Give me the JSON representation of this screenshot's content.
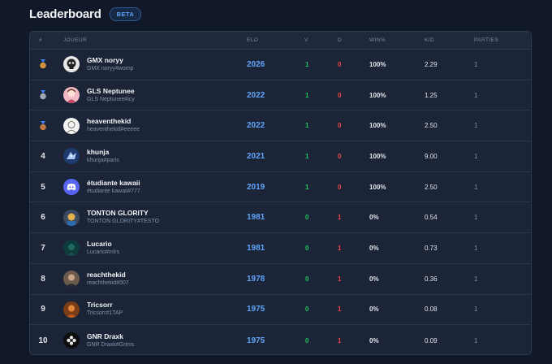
{
  "header": {
    "title": "Leaderboard",
    "badge": "BETA"
  },
  "columns": {
    "rank": "#",
    "player": "JOUEUR",
    "elo": "ELO",
    "wins": "V",
    "losses": "D",
    "winrate": "WIN%",
    "kd": "K/D",
    "games": "PARTIES"
  },
  "colors": {
    "accent": "#60a5fa",
    "win": "#22c55e",
    "loss": "#ef4444",
    "gold": "#d08c34",
    "silver": "#9ca3af",
    "bronze": "#b8703a"
  },
  "rows": [
    {
      "rank": "",
      "medal": "gold",
      "name": "GMX noryy",
      "tag": "GMX noryy#womp",
      "elo": "2026",
      "wins": "1",
      "losses": "0",
      "winrate": "100%",
      "kd": "2.29",
      "games": "1",
      "avatar": "skull-avatar"
    },
    {
      "rank": "",
      "medal": "silver",
      "name": "GLS Neptunee",
      "tag": "GLS Neptunee#icy",
      "elo": "2022",
      "wins": "1",
      "losses": "0",
      "winrate": "100%",
      "kd": "1.25",
      "games": "1",
      "avatar": "pink-character-avatar"
    },
    {
      "rank": "",
      "medal": "bronze",
      "name": "heaventhekid",
      "tag": "heaventhekid#eeeee",
      "elo": "2022",
      "wins": "1",
      "losses": "0",
      "winrate": "100%",
      "kd": "2.50",
      "games": "1",
      "avatar": "sketch-avatar"
    },
    {
      "rank": "4",
      "medal": "",
      "name": "khunja",
      "tag": "khunja#paris",
      "elo": "2021",
      "wins": "1",
      "losses": "0",
      "winrate": "100%",
      "kd": "9.00",
      "games": "1",
      "avatar": "blue-dragon-avatar"
    },
    {
      "rank": "5",
      "medal": "",
      "name": "étudiante kawaii",
      "tag": "étudiante kawaii#777",
      "elo": "2019",
      "wins": "1",
      "losses": "0",
      "winrate": "100%",
      "kd": "2.50",
      "games": "1",
      "avatar": "discord-default-avatar"
    },
    {
      "rank": "6",
      "medal": "",
      "name": "TONTON GLORITY",
      "tag": "TONTON GLORITY#TESTO",
      "elo": "1981",
      "wins": "0",
      "losses": "1",
      "winrate": "0%",
      "kd": "0.54",
      "games": "1",
      "avatar": "cartoon-avatar"
    },
    {
      "rank": "7",
      "medal": "",
      "name": "Lucario",
      "tag": "Lucario#mlrs",
      "elo": "1981",
      "wins": "0",
      "losses": "1",
      "winrate": "0%",
      "kd": "0.73",
      "games": "1",
      "avatar": "dark-teal-avatar"
    },
    {
      "rank": "8",
      "medal": "",
      "name": "reachthekid",
      "tag": "reachthekid#007",
      "elo": "1978",
      "wins": "0",
      "losses": "1",
      "winrate": "0%",
      "kd": "0.36",
      "games": "1",
      "avatar": "photo-avatar"
    },
    {
      "rank": "9",
      "medal": "",
      "name": "Tricsorr",
      "tag": "Tricsorr#1TAP",
      "elo": "1975",
      "wins": "0",
      "losses": "1",
      "winrate": "0%",
      "kd": "0.08",
      "games": "1",
      "avatar": "orange-character-avatar"
    },
    {
      "rank": "10",
      "medal": "",
      "name": "GNR Draxk",
      "tag": "GNR Draxk#Grims",
      "elo": "1975",
      "wins": "0",
      "losses": "1",
      "winrate": "0%",
      "kd": "0.09",
      "games": "1",
      "avatar": "flower-avatar"
    }
  ]
}
